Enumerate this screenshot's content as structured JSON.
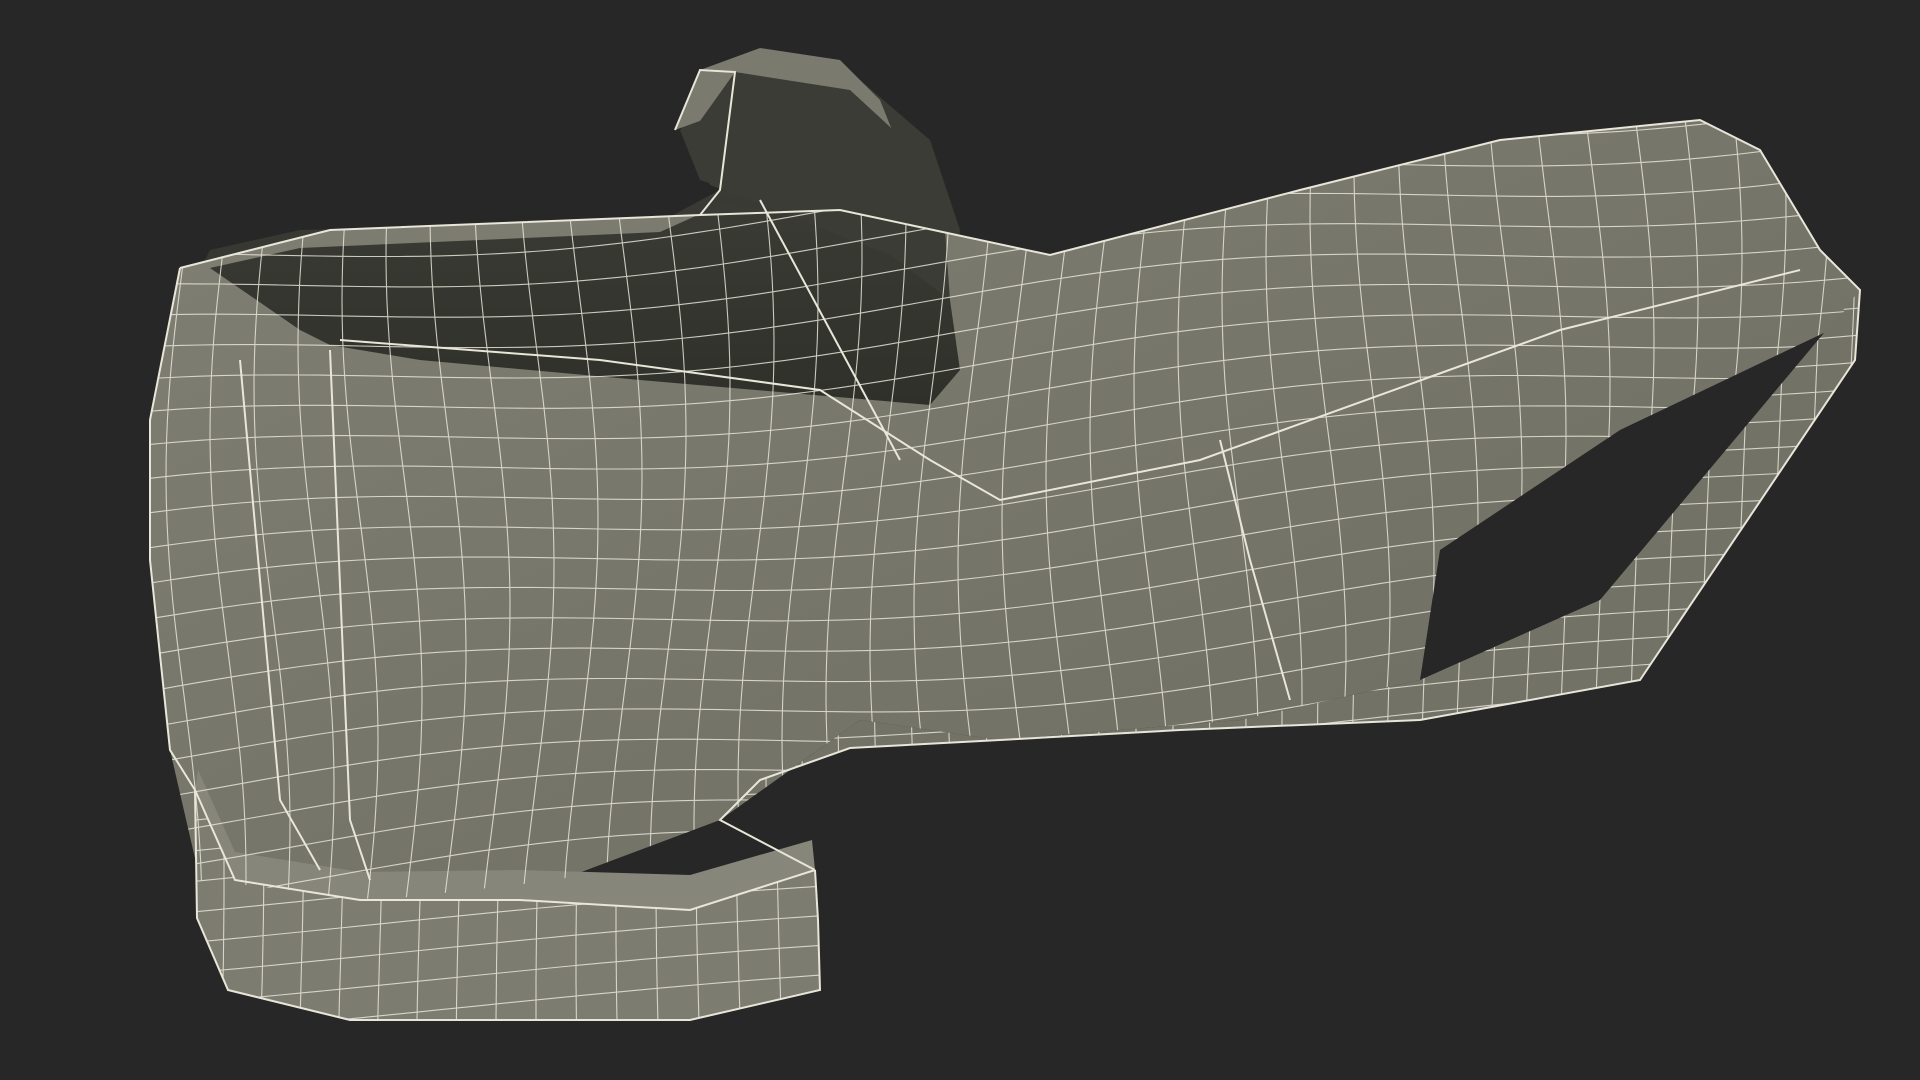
{
  "scene": {
    "subject": "loafer-shoe-wireframe",
    "render_mode": "wireframe-over-shaded",
    "colors": {
      "background": "#272727",
      "shell": "#7a7a6e",
      "shell_shadow": "#6a6a5f",
      "interior": "#3e3f37",
      "interior_deep": "#33342e",
      "wire": "#e8e6d8",
      "edge_dark": "#4d4d44"
    }
  }
}
